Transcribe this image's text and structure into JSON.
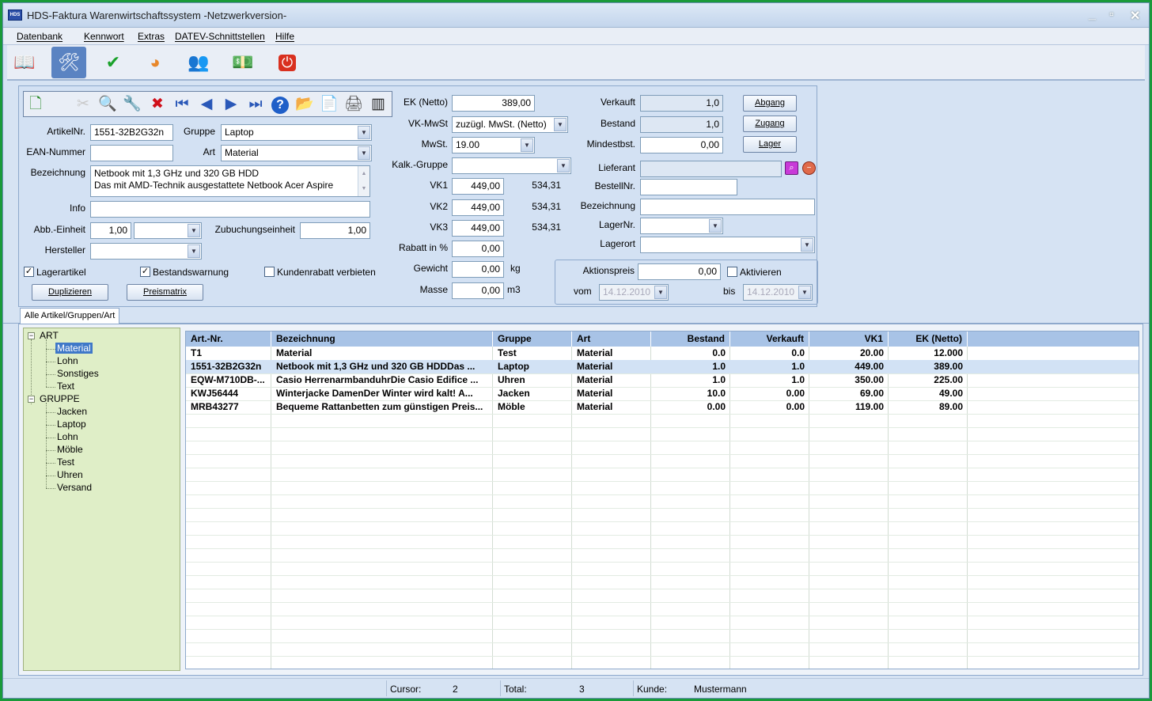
{
  "window": {
    "title": "HDS-Faktura Warenwirtschaftssystem -Netzwerkversion-",
    "app_icon": "HDS",
    "close_glyph": "✕",
    "min_glyph": "_",
    "max_glyph": "▫"
  },
  "menu": [
    "Datenbank",
    "Kennwort",
    "Extras",
    "DATEV-Schnittstellen",
    "Hilfe"
  ],
  "toolbar": [
    {
      "name": "address-book-icon",
      "glyph": "📖"
    },
    {
      "name": "tools-icon",
      "glyph": "🛠"
    },
    {
      "name": "checkmark-icon",
      "glyph": "✔"
    },
    {
      "name": "pie-chart-icon",
      "glyph": "◕"
    },
    {
      "name": "people-icon",
      "glyph": "👥"
    },
    {
      "name": "money-icon",
      "glyph": "💵"
    },
    {
      "name": "power-icon",
      "glyph": "⏻"
    }
  ],
  "form_toolbar": [
    {
      "name": "new-record-icon",
      "glyph": "🗋"
    },
    {
      "name": "blank-icon",
      "glyph": ""
    },
    {
      "name": "cut-icon",
      "glyph": "✂"
    },
    {
      "name": "search-icon",
      "glyph": "🔍"
    },
    {
      "name": "search-tool-icon",
      "glyph": "🔧"
    },
    {
      "name": "delete-icon",
      "glyph": "✖"
    },
    {
      "name": "first-record-icon",
      "glyph": "⏮"
    },
    {
      "name": "previous-record-icon",
      "glyph": "◀"
    },
    {
      "name": "next-record-icon",
      "glyph": "▶"
    },
    {
      "name": "last-record-icon",
      "glyph": "⏭"
    },
    {
      "name": "help-icon",
      "glyph": "?"
    },
    {
      "name": "open-folder-icon",
      "glyph": "📂"
    },
    {
      "name": "document-search-icon",
      "glyph": "📄"
    },
    {
      "name": "print-icon",
      "glyph": "🖨"
    },
    {
      "name": "barcode-icon",
      "glyph": "▥"
    }
  ],
  "form": {
    "artikelnr": {
      "label": "ArtikelNr.",
      "value": "1551-32B2G32n"
    },
    "gruppe": {
      "label": "Gruppe",
      "value": "Laptop"
    },
    "ean": {
      "label": "EAN-Nummer",
      "value": ""
    },
    "art": {
      "label": "Art",
      "value": "Material"
    },
    "bezeichnung": {
      "label": "Bezeichnung",
      "line1": "Netbook mit 1,3 GHz und 320 GB HDD",
      "line2": "Das mit AMD-Technik ausgestattete Netbook Acer Aspire"
    },
    "info": {
      "label": "Info",
      "value": ""
    },
    "abb_einheit": {
      "label": "Abb.-Einheit",
      "value": "1,00"
    },
    "zubuchungseinheit": {
      "label": "Zubuchungseinheit",
      "value": "1,00"
    },
    "hersteller": {
      "label": "Hersteller",
      "value": ""
    },
    "lagerartikel": {
      "label": "Lagerartikel",
      "checked": true
    },
    "bestandswarnung": {
      "label": "Bestandswarnung",
      "checked": true
    },
    "kundenrabatt": {
      "label": "Kundenrabatt verbieten",
      "checked": false
    },
    "duplizieren": "Duplizieren",
    "preismatrix": "Preismatrix",
    "ek_netto": {
      "label": "EK (Netto)",
      "value": "389,00"
    },
    "vk_mwst": {
      "label": "VK-MwSt",
      "value": "zuzügl. MwSt. (Netto)"
    },
    "mwst": {
      "label": "MwSt.",
      "value": "19.00"
    },
    "kalk_gruppe": {
      "label": "Kalk.-Gruppe",
      "value": ""
    },
    "vk1": {
      "label": "VK1",
      "value": "449,00",
      "gross": "534,31"
    },
    "vk2": {
      "label": "VK2",
      "value": "449,00",
      "gross": "534,31"
    },
    "vk3": {
      "label": "VK3",
      "value": "449,00",
      "gross": "534,31"
    },
    "rabatt": {
      "label": "Rabatt in %",
      "value": "0,00"
    },
    "gewicht": {
      "label": "Gewicht",
      "value": "0,00",
      "unit": "kg"
    },
    "masse": {
      "label": "Masse",
      "value": "0,00",
      "unit": "m3"
    },
    "verkauft": {
      "label": "Verkauft",
      "value": "1,0"
    },
    "bestand": {
      "label": "Bestand",
      "value": "1,0"
    },
    "mindestbst": {
      "label": "Mindestbst.",
      "value": "0,00"
    },
    "abgang": "Abgang",
    "zugang": "Zugang",
    "lager": "Lager",
    "lieferant": {
      "label": "Lieferant",
      "value": ""
    },
    "bestellnr": {
      "label": "BestellNr.",
      "value": ""
    },
    "bezeichnung2": {
      "label": "Bezeichnung",
      "value": ""
    },
    "lagernr": {
      "label": "LagerNr.",
      "value": ""
    },
    "lagerort": {
      "label": "Lagerort",
      "value": ""
    },
    "aktionspreis": {
      "label": "Aktionspreis",
      "value": "0,00"
    },
    "aktivieren": {
      "label": "Aktivieren",
      "checked": false
    },
    "vom": {
      "label": "vom",
      "value": "14.12.2010"
    },
    "bis": {
      "label": "bis",
      "value": "14.12.2010"
    }
  },
  "tab": "Alle Artikel/Gruppen/Art",
  "tree": {
    "art": {
      "label": "ART",
      "children": [
        "Material",
        "Lohn",
        "Sonstiges",
        "Text"
      ],
      "selected": "Material"
    },
    "gruppe": {
      "label": "GRUPPE",
      "children": [
        "Jacken",
        "Laptop",
        "Lohn",
        "Möble",
        "Test",
        "Uhren",
        "Versand"
      ]
    }
  },
  "grid": {
    "columns": [
      "Art.-Nr.",
      "Bezeichnung",
      "Gruppe",
      "Art",
      "Bestand",
      "Verkauft",
      "VK1",
      "EK (Netto)"
    ],
    "rows": [
      [
        "T1",
        "Material",
        "Test",
        "Material",
        "0.0",
        "0.0",
        "20.00",
        "12.000"
      ],
      [
        "1551-32B2G32n",
        "Netbook mit 1,3 GHz und 320 GB HDDDas ...",
        "Laptop",
        "Material",
        "1.0",
        "1.0",
        "449.00",
        "389.00"
      ],
      [
        "EQW-M710DB-...",
        "Casio HerrenarmbanduhrDie Casio Edifice ...",
        "Uhren",
        "Material",
        "1.0",
        "1.0",
        "350.00",
        "225.00"
      ],
      [
        "KWJ56444",
        "Winterjacke DamenDer Winter wird kalt! A...",
        "Jacken",
        "Material",
        "10.0",
        "0.00",
        "69.00",
        "49.00"
      ],
      [
        "MRB43277",
        "Bequeme Rattanbetten zum günstigen Preis...",
        "Möble",
        "Material",
        "0.00",
        "0.00",
        "119.00",
        "89.00"
      ]
    ],
    "selected_row": 1
  },
  "status": {
    "cursor_label": "Cursor:",
    "cursor_value": "2",
    "total_label": "Total:",
    "total_value": "3",
    "kunde_label": "Kunde:",
    "kunde_value": "Mustermann"
  },
  "colors": {
    "accent": "#3f78c8",
    "grid_header": "#a8c3e6",
    "tree_bg": "#dfeec7",
    "window_bg": "#d6e3f3",
    "frame": "#1a9a3a"
  }
}
